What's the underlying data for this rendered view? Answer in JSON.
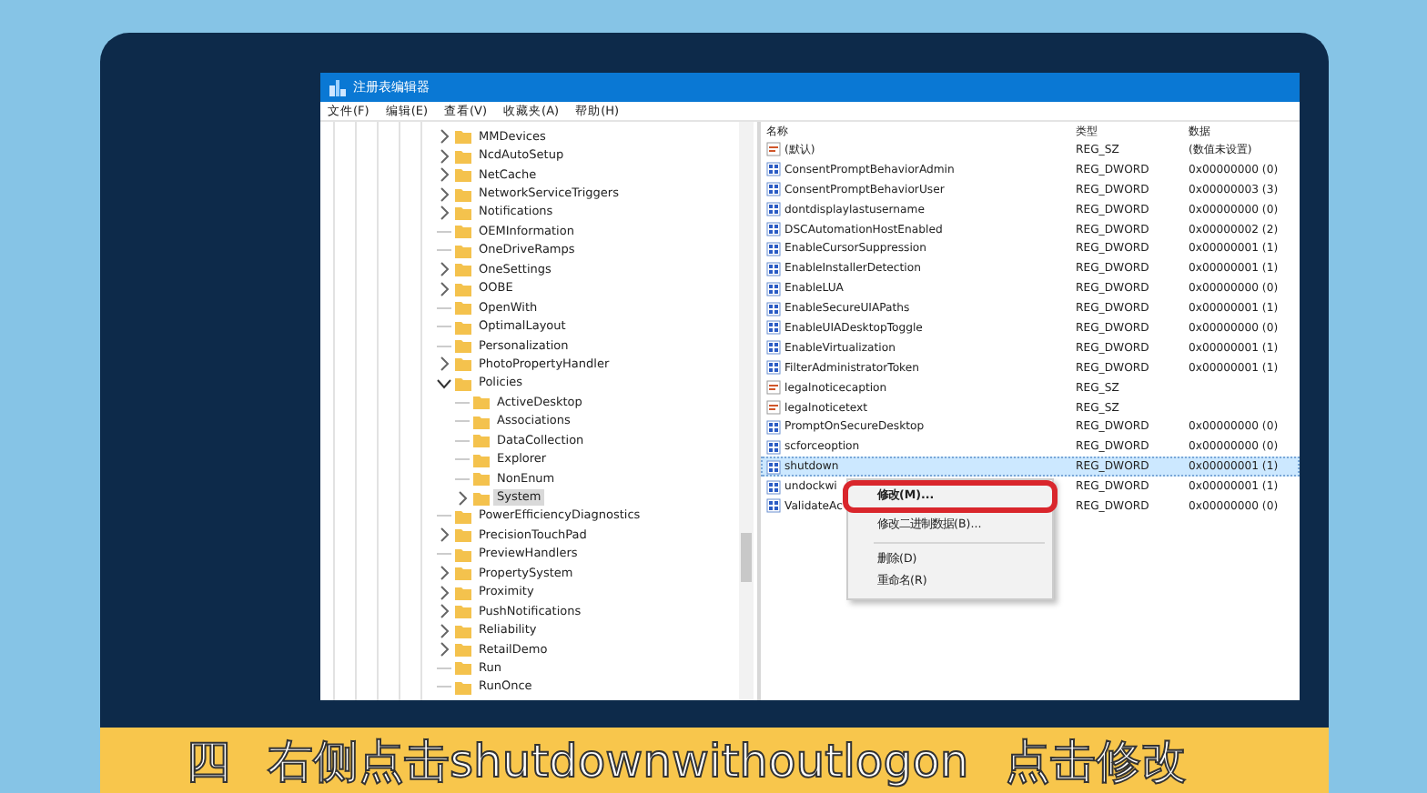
{
  "window": {
    "title": "注册表编辑器"
  },
  "menu": [
    "文件(F)",
    "编辑(E)",
    "查看(V)",
    "收藏夹(A)",
    "帮助(H)"
  ],
  "tree": [
    {
      "label": "MMDevices",
      "expandable": true,
      "expanded": false,
      "selected": false
    },
    {
      "label": "NcdAutoSetup",
      "expandable": true,
      "expanded": false,
      "selected": false
    },
    {
      "label": "NetCache",
      "expandable": true,
      "expanded": false,
      "selected": false
    },
    {
      "label": "NetworkServiceTriggers",
      "expandable": true,
      "expanded": false,
      "selected": false
    },
    {
      "label": "Notifications",
      "expandable": true,
      "expanded": false,
      "selected": false
    },
    {
      "label": "OEMInformation",
      "expandable": false,
      "selected": false
    },
    {
      "label": "OneDriveRamps",
      "expandable": false,
      "selected": false
    },
    {
      "label": "OneSettings",
      "expandable": true,
      "expanded": false,
      "selected": false
    },
    {
      "label": "OOBE",
      "expandable": true,
      "expanded": false,
      "selected": false
    },
    {
      "label": "OpenWith",
      "expandable": false,
      "selected": false
    },
    {
      "label": "OptimalLayout",
      "expandable": false,
      "selected": false
    },
    {
      "label": "Personalization",
      "expandable": false,
      "selected": false
    },
    {
      "label": "PhotoPropertyHandler",
      "expandable": true,
      "expanded": false,
      "selected": false
    },
    {
      "label": "Policies",
      "expandable": true,
      "expanded": true,
      "selected": false,
      "children": [
        {
          "label": "ActiveDesktop",
          "expandable": false,
          "selected": false
        },
        {
          "label": "Associations",
          "expandable": false,
          "selected": false
        },
        {
          "label": "DataCollection",
          "expandable": false,
          "selected": false
        },
        {
          "label": "Explorer",
          "expandable": false,
          "selected": false
        },
        {
          "label": "NonEnum",
          "expandable": false,
          "selected": false
        },
        {
          "label": "System",
          "expandable": true,
          "expanded": false,
          "selected": true
        }
      ]
    },
    {
      "label": "PowerEfficiencyDiagnostics",
      "expandable": false,
      "selected": false
    },
    {
      "label": "PrecisionTouchPad",
      "expandable": true,
      "expanded": false,
      "selected": false
    },
    {
      "label": "PreviewHandlers",
      "expandable": false,
      "selected": false
    },
    {
      "label": "PropertySystem",
      "expandable": true,
      "expanded": false,
      "selected": false
    },
    {
      "label": "Proximity",
      "expandable": true,
      "expanded": false,
      "selected": false
    },
    {
      "label": "PushNotifications",
      "expandable": true,
      "expanded": false,
      "selected": false
    },
    {
      "label": "Reliability",
      "expandable": true,
      "expanded": false,
      "selected": false
    },
    {
      "label": "RetailDemo",
      "expandable": true,
      "expanded": false,
      "selected": false
    },
    {
      "label": "Run",
      "expandable": false,
      "selected": false
    },
    {
      "label": "RunOnce",
      "expandable": false,
      "selected": false
    }
  ],
  "columns": [
    "名称",
    "类型",
    "数据"
  ],
  "rows": [
    {
      "kind": "string",
      "name": "(默认)",
      "type": "REG_SZ",
      "data": "(数值未设置)",
      "selected": false
    },
    {
      "kind": "dword",
      "name": "ConsentPromptBehaviorAdmin",
      "type": "REG_DWORD",
      "data": "0x00000000 (0)",
      "selected": false
    },
    {
      "kind": "dword",
      "name": "ConsentPromptBehaviorUser",
      "type": "REG_DWORD",
      "data": "0x00000003 (3)",
      "selected": false
    },
    {
      "kind": "dword",
      "name": "dontdisplaylastusername",
      "type": "REG_DWORD",
      "data": "0x00000000 (0)",
      "selected": false
    },
    {
      "kind": "dword",
      "name": "DSCAutomationHostEnabled",
      "type": "REG_DWORD",
      "data": "0x00000002 (2)",
      "selected": false
    },
    {
      "kind": "dword",
      "name": "EnableCursorSuppression",
      "type": "REG_DWORD",
      "data": "0x00000001 (1)",
      "selected": false
    },
    {
      "kind": "dword",
      "name": "EnableInstallerDetection",
      "type": "REG_DWORD",
      "data": "0x00000001 (1)",
      "selected": false
    },
    {
      "kind": "dword",
      "name": "EnableLUA",
      "type": "REG_DWORD",
      "data": "0x00000000 (0)",
      "selected": false
    },
    {
      "kind": "dword",
      "name": "EnableSecureUIAPaths",
      "type": "REG_DWORD",
      "data": "0x00000001 (1)",
      "selected": false
    },
    {
      "kind": "dword",
      "name": "EnableUIADesktopToggle",
      "type": "REG_DWORD",
      "data": "0x00000000 (0)",
      "selected": false
    },
    {
      "kind": "dword",
      "name": "EnableVirtualization",
      "type": "REG_DWORD",
      "data": "0x00000001 (1)",
      "selected": false
    },
    {
      "kind": "dword",
      "name": "FilterAdministratorToken",
      "type": "REG_DWORD",
      "data": "0x00000001 (1)",
      "selected": false
    },
    {
      "kind": "string",
      "name": "legalnoticecaption",
      "type": "REG_SZ",
      "selected": false
    },
    {
      "kind": "string",
      "name": "legalnoticetext",
      "type": "REG_SZ",
      "selected": false
    },
    {
      "kind": "dword",
      "name": "PromptOnSecureDesktop",
      "type": "REG_DWORD",
      "data": "0x00000000 (0)",
      "selected": false
    },
    {
      "kind": "dword",
      "name": "scforceoption",
      "type": "REG_DWORD",
      "data": "0x00000000 (0)",
      "selected": false
    },
    {
      "kind": "dword",
      "name": "shutdown",
      "type": "REG_DWORD",
      "data": "0x00000001 (1)",
      "selected": true
    },
    {
      "kind": "dword",
      "name": "undockwi",
      "type": "REG_DWORD",
      "data": "0x00000001 (1)",
      "selected": false
    },
    {
      "kind": "dword",
      "name": "ValidateAc",
      "type": "REG_DWORD",
      "data": "0x00000000 (0)",
      "selected": false
    }
  ],
  "context_menu": {
    "groups": [
      [
        {
          "label": "修改(M)...",
          "highlighted": true
        },
        {
          "label": "修改二进制数据(B)...",
          "highlighted": false
        }
      ],
      [
        {
          "label": "删除(D)",
          "highlighted": false
        },
        {
          "label": "重命名(R)",
          "highlighted": false
        }
      ]
    ]
  },
  "caption": {
    "step": "四",
    "parts": [
      "右侧点击shutdownwithoutlogon",
      "点击修改"
    ]
  }
}
